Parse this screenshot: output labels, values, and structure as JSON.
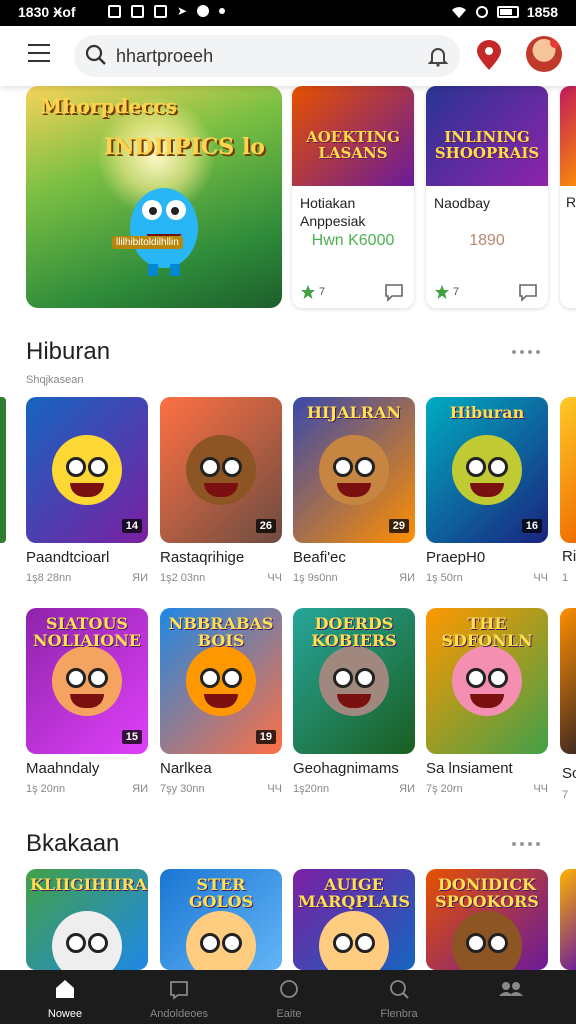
{
  "status_bar": {
    "time_left": "1830 Ӿоf",
    "time_right": "1858"
  },
  "search": {
    "query": "hhartproeeh"
  },
  "featured": {
    "title_top": "Mhorpdeccs",
    "title_main": "INDIIPICS lo",
    "subtitle": "llilhibitoldilhllin"
  },
  "top_cards": [
    {
      "art_text": "AOEKTING LASANS",
      "name": "Hotiakan Anppesiak",
      "price": "Hwn K6000",
      "rating": "7",
      "colors": [
        "#e65100",
        "#6a1b9a"
      ]
    },
    {
      "art_text": "INLINING SHOOPRAIS",
      "name": "Naodbay",
      "price": "1890",
      "rating": "7",
      "colors": [
        "#283593",
        "#8e24aa"
      ]
    }
  ],
  "peek_card": {
    "name": "R"
  },
  "sections": [
    {
      "title": "Hiburan",
      "subtitle": "Shqjkasean"
    },
    {
      "title": "Bkakaan"
    }
  ],
  "row1": [
    {
      "name": "Paandtcioarl",
      "size": "1ş8 28nn",
      "badge_right": "ЯИ",
      "badge": "14",
      "art_text": "",
      "colors": [
        "#1565c0",
        "#7b1fa2"
      ],
      "face": "#fdd835"
    },
    {
      "name": "Rastaqrihige",
      "size": "1ş2 03nn",
      "badge_right": "ЧЧ",
      "badge": "26",
      "art_text": "",
      "colors": [
        "#ff7043",
        "#6d4c41"
      ],
      "face": "#8d5524"
    },
    {
      "name": "Beafi'ec",
      "size": "1ş 9s0nn",
      "badge_right": "ЯИ",
      "badge": "29",
      "art_text": "HIJALRAN",
      "colors": [
        "#3949ab",
        "#ff8f00"
      ],
      "face": "#c68642"
    },
    {
      "name": "PraepH0",
      "size": "1ş 50rn",
      "badge_right": "ЧЧ",
      "badge": "16",
      "art_text": "Hiburan",
      "colors": [
        "#00acc1",
        "#1a237e"
      ],
      "face": "#c0ca33"
    }
  ],
  "row2": [
    {
      "name": "Maahndaly",
      "size": "1ş 20nn",
      "badge_right": "ЯИ",
      "badge": "15",
      "art_text": "SIATOUS NOLIAIONE",
      "colors": [
        "#8e24aa",
        "#e040fb"
      ],
      "face": "#f4a460"
    },
    {
      "name": "Narlkea",
      "size": "7şy 30nn",
      "badge_right": "ЧЧ",
      "badge": "19",
      "art_text": "NBBRABAS BOIS",
      "colors": [
        "#1e88e5",
        "#ff7043"
      ],
      "face": "#ff9800"
    },
    {
      "name": "Geohagnimams",
      "size": "1ş20nn",
      "badge_right": "ЯИ",
      "badge": "",
      "art_text": "DOERDS KOBIERS",
      "colors": [
        "#26a69a",
        "#1b5e20"
      ],
      "face": "#a1887f"
    },
    {
      "name": "Sa lnsiament",
      "size": "7ş 20rn",
      "badge_right": "ЧЧ",
      "badge": "",
      "art_text": "THE SDFONLN",
      "colors": [
        "#ff9800",
        "#43a047"
      ],
      "face": "#f48fb1"
    }
  ],
  "row2_peek": {
    "name": "Sc",
    "size": "7"
  },
  "row1_peek": {
    "name": "Ri",
    "size": "1"
  },
  "row3": [
    {
      "art_text": "KLIIGIHIIRAN",
      "colors": [
        "#43a047",
        "#1e88e5"
      ],
      "face": "#eeeeee"
    },
    {
      "art_text": "STER GOLOS",
      "colors": [
        "#1976d2",
        "#64b5f6"
      ],
      "face": "#ffcc80"
    },
    {
      "art_text": "AUIGE MARQPLAIS",
      "colors": [
        "#7b1fa2",
        "#1565c0"
      ],
      "face": "#ffcc80"
    },
    {
      "art_text": "DONIDICK SPOOKORS",
      "colors": [
        "#e65100",
        "#6a1b9a"
      ],
      "face": "#8d5524"
    }
  ],
  "bottom_nav": [
    {
      "label": "Nowee",
      "icon": "home-icon",
      "active": true
    },
    {
      "label": "Andoldeoes",
      "icon": "apps-icon",
      "active": false
    },
    {
      "label": "Eaite",
      "icon": "circle-icon",
      "active": false
    },
    {
      "label": "Flenbra",
      "icon": "search-icon",
      "active": false
    },
    {
      "label": "",
      "icon": "people-icon",
      "active": false
    }
  ]
}
